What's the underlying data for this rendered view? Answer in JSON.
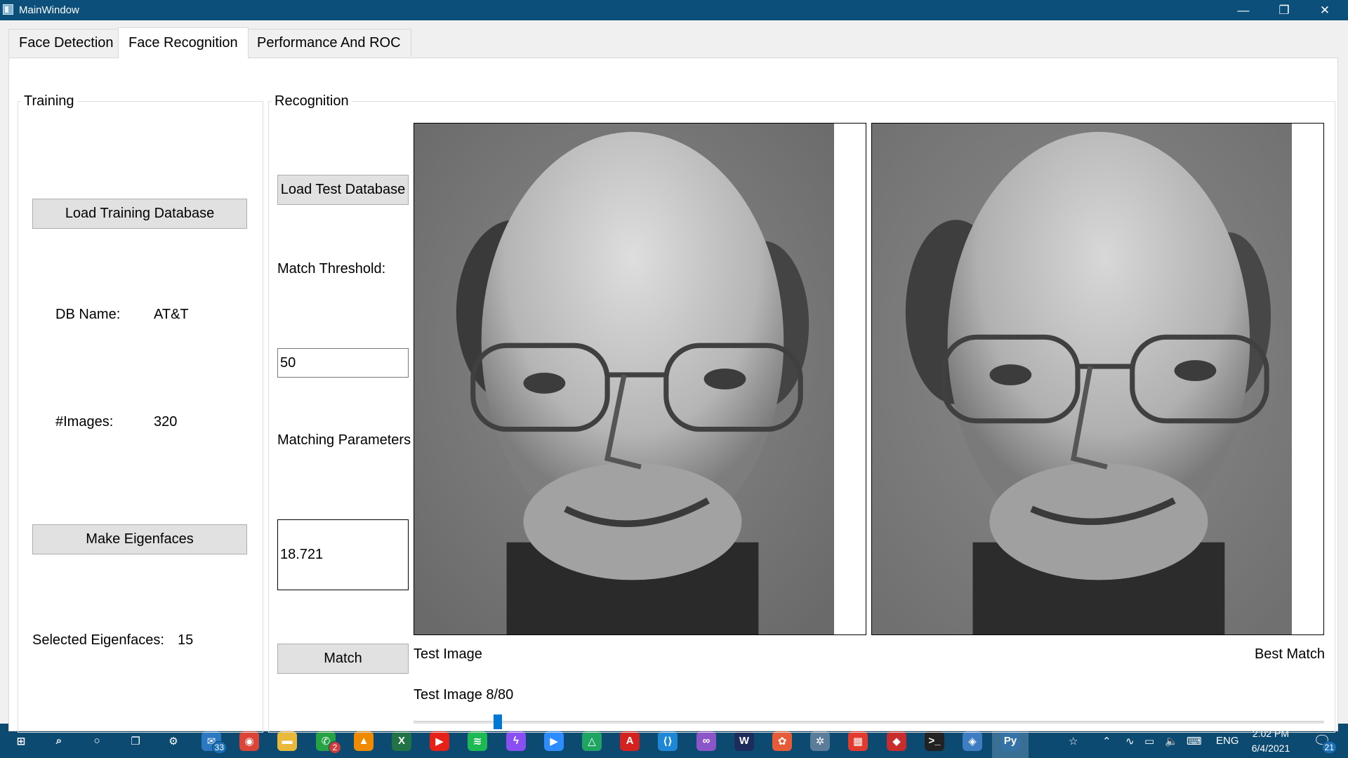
{
  "window": {
    "title": "MainWindow",
    "minimize_icon": "minimize-icon",
    "maximize_icon": "restore-icon",
    "close_icon": "close-icon"
  },
  "tabs": [
    {
      "label": "Face Detection",
      "active": false
    },
    {
      "label": "Face Recognition",
      "active": true
    },
    {
      "label": "Performance And ROC",
      "active": false
    }
  ],
  "training": {
    "group_title": "Training",
    "load_button": "Load Training Database",
    "db_name_label": "DB Name:",
    "db_name_value": "AT&T",
    "images_label": "#Images:",
    "images_value": "320",
    "make_button": "Make Eigenfaces",
    "selected_label": "Selected Eigenfaces:",
    "selected_value": "15"
  },
  "recognition": {
    "group_title": "Recognition",
    "load_test_button": "Load Test Database",
    "threshold_label": "Match Threshold:",
    "threshold_value": "50",
    "params_label": "Matching Parameters",
    "params_value": "18.721",
    "match_button": "Match",
    "test_image_caption": "Test Image",
    "best_match_caption": "Best Match",
    "test_image_counter": "Test Image 8/80",
    "slider": {
      "value": 8,
      "max": 80
    }
  },
  "taskbar": {
    "items": [
      {
        "name": "start-icon",
        "glyph": "⊞",
        "color": ""
      },
      {
        "name": "search-icon",
        "glyph": "⌕",
        "color": ""
      },
      {
        "name": "cortana-icon",
        "glyph": "○",
        "color": ""
      },
      {
        "name": "task-view-icon",
        "glyph": "❐",
        "color": ""
      },
      {
        "name": "settings-icon",
        "glyph": "⚙",
        "color": ""
      },
      {
        "name": "mail-icon",
        "glyph": "✉",
        "color": "#2b79c2",
        "badge": "33"
      },
      {
        "name": "chrome-icon",
        "glyph": "◉",
        "color": "#db4437"
      },
      {
        "name": "file-explorer-icon",
        "glyph": "▬",
        "color": "#e8b93a"
      },
      {
        "name": "whatsapp-icon",
        "glyph": "✆",
        "color": "#25a244",
        "badge": "2"
      },
      {
        "name": "vlc-icon",
        "glyph": "▲",
        "color": "#f08a00"
      },
      {
        "name": "excel-icon",
        "glyph": "X",
        "color": "#217346"
      },
      {
        "name": "youtube-music-icon",
        "glyph": "▶",
        "color": "#e62117"
      },
      {
        "name": "spotify-icon",
        "glyph": "≋",
        "color": "#1db954"
      },
      {
        "name": "messenger-icon",
        "glyph": "ϟ",
        "color": "#8a4ff2"
      },
      {
        "name": "zoom-icon",
        "glyph": "▶",
        "color": "#2d8cff"
      },
      {
        "name": "google-drive-icon",
        "glyph": "△",
        "color": "#1fa463"
      },
      {
        "name": "acrobat-icon",
        "glyph": "A",
        "color": "#d4231e"
      },
      {
        "name": "vscode-icon",
        "glyph": "⟨⟩",
        "color": "#1e88d6"
      },
      {
        "name": "visual-studio-icon",
        "glyph": "∞",
        "color": "#8c55c8"
      },
      {
        "name": "app-w-icon",
        "glyph": "W",
        "color": "#1d2c5a"
      },
      {
        "name": "app-red-icon",
        "glyph": "✿",
        "color": "#e85b38"
      },
      {
        "name": "app-atom-icon",
        "glyph": "✲",
        "color": "#5b7d9a"
      },
      {
        "name": "app-grid-icon",
        "glyph": "▦",
        "color": "#e23b2e"
      },
      {
        "name": "app-cube-icon",
        "glyph": "◆",
        "color": "#c92c2c"
      },
      {
        "name": "terminal-icon",
        "glyph": ">_",
        "color": "#222222"
      },
      {
        "name": "git-icon",
        "glyph": "◈",
        "color": "#3d7ec2"
      },
      {
        "name": "python-icon",
        "glyph": "Py",
        "color": "#3572a5"
      }
    ],
    "tray": {
      "people_icon": "people-icon",
      "chevron_icon": "chevron-up-icon",
      "wifi_icon": "wifi-icon",
      "battery_icon": "battery-icon",
      "volume_icon": "volume-icon",
      "keyboard_icon": "keyboard-icon",
      "language": "ENG",
      "time": "2:02 PM",
      "date": "6/4/2021",
      "notifications_badge": "21"
    }
  }
}
